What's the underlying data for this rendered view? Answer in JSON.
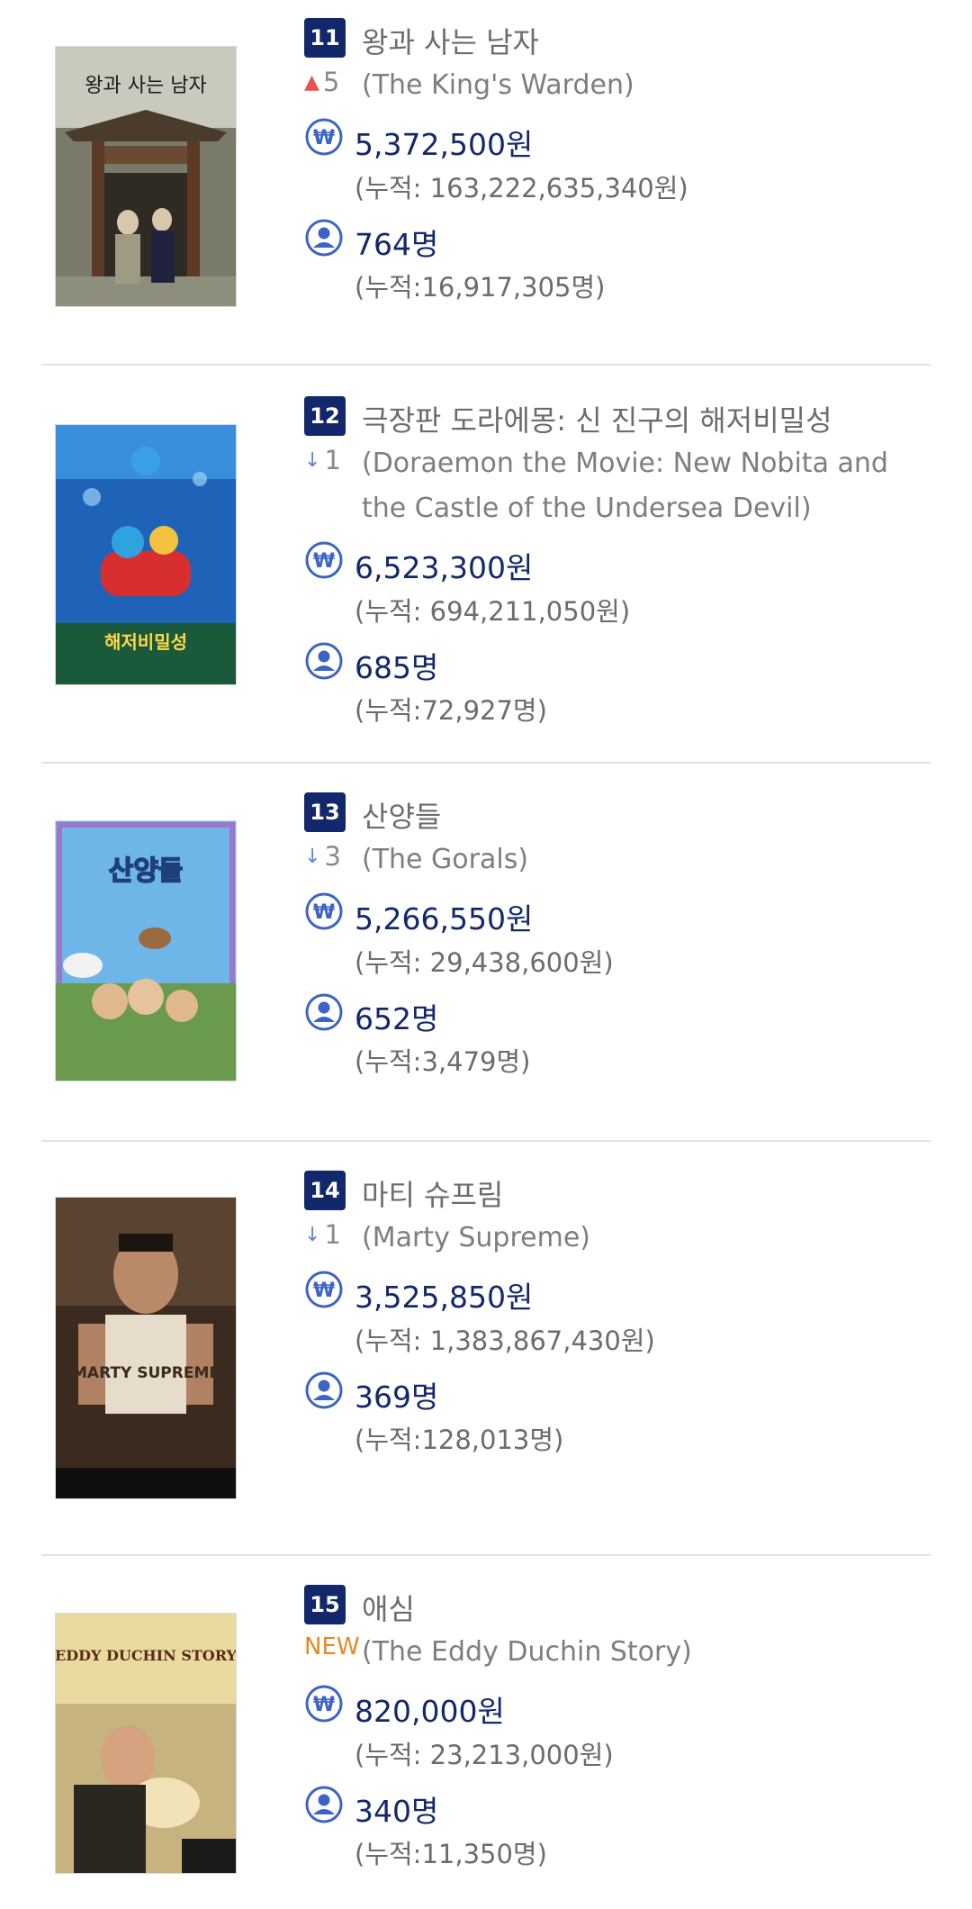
{
  "items": [
    {
      "rank": "11",
      "change_label": "5",
      "change_dir": "up",
      "title_ko": "왕과 사는 남자",
      "title_en": "(The King's Warden)",
      "revenue": "5,372,500원",
      "revenue_total": "(누적: 163,222,635,340원)",
      "audience": "764명",
      "audience_total": "(누적:16,917,305명)",
      "poster_text": "왕과 사는 남자"
    },
    {
      "rank": "12",
      "change_label": "1",
      "change_dir": "down",
      "title_ko": "극장판 도라에몽: 신 진구의 해저비밀성",
      "title_en": "(Doraemon the Movie: New Nobita and the Castle of the Undersea Devil)",
      "revenue": "6,523,300원",
      "revenue_total": "(누적: 694,211,050원)",
      "audience": "685명",
      "audience_total": "(누적:72,927명)",
      "poster_text": "해저비밀성"
    },
    {
      "rank": "13",
      "change_label": "3",
      "change_dir": "down",
      "title_ko": "산양들",
      "title_en": "(The Gorals)",
      "revenue": "5,266,550원",
      "revenue_total": "(누적: 29,438,600원)",
      "audience": "652명",
      "audience_total": "(누적:3,479명)",
      "poster_text": "산양들"
    },
    {
      "rank": "14",
      "change_label": "1",
      "change_dir": "down",
      "title_ko": "마티 슈프림",
      "title_en": "(Marty Supreme)",
      "revenue": "3,525,850원",
      "revenue_total": "(누적: 1,383,867,430원)",
      "audience": "369명",
      "audience_total": "(누적:128,013명)",
      "poster_text": "MARTY SUPREME"
    },
    {
      "rank": "15",
      "change_label": "NEW",
      "change_dir": "new",
      "title_ko": "애심",
      "title_en": "(The Eddy Duchin Story)",
      "revenue": "820,000원",
      "revenue_total": "(누적: 23,213,000원)",
      "audience": "340명",
      "audience_total": "(누적:11,350명)",
      "poster_text": "EDDY DUCHIN STORY"
    }
  ],
  "icons": {
    "arrow_up": "▲",
    "arrow_down": "↓",
    "won": "won-icon",
    "person": "person-icon"
  },
  "colors": {
    "rank_bg": "#13286a",
    "value": "#13286a",
    "up": "#e8534a",
    "down": "#5e86d4",
    "new": "#e38a22"
  }
}
